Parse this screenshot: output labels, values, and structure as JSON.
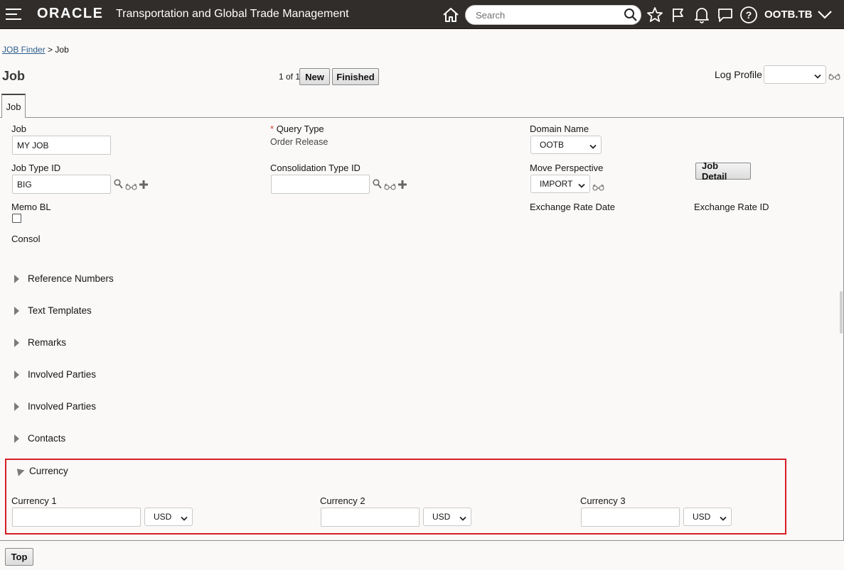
{
  "header": {
    "brand": "ORACLE",
    "app_title": "Transportation and Global Trade Management",
    "search_placeholder": "Search",
    "user": "OOTB.TB"
  },
  "breadcrumb": {
    "link": "JOB Finder",
    "separator": ">",
    "current": "Job"
  },
  "page": {
    "title": "Job",
    "count": "1 of 1",
    "new_label": "New",
    "finished_label": "Finished",
    "log_profile_label": "Log Profile",
    "log_profile_value": ""
  },
  "tab": {
    "label": "Job"
  },
  "form": {
    "job_label": "Job",
    "job_value": "MY JOB",
    "query_type_required": "*",
    "query_type_label": "Query Type",
    "query_type_value": "Order Release",
    "domain_name_label": "Domain Name",
    "domain_name_value": "OOTB",
    "job_type_label": "Job Type ID",
    "job_type_value": "BIG",
    "consolidation_label": "Consolidation Type ID",
    "consolidation_value": "",
    "move_perspective_label": "Move Perspective",
    "move_perspective_value": "IMPORT",
    "job_detail_label": "Job Detail",
    "memo_bl_label": "Memo BL",
    "exchange_rate_date_label": "Exchange Rate Date",
    "exchange_rate_id_label": "Exchange Rate ID",
    "consol_label": "Consol"
  },
  "sections": [
    "Reference Numbers",
    "Text Templates",
    "Remarks",
    "Involved Parties",
    "Involved Parties",
    "Contacts"
  ],
  "currency": {
    "title": "Currency",
    "fields": [
      {
        "label": "Currency 1",
        "value": "",
        "unit": "USD"
      },
      {
        "label": "Currency 2",
        "value": "",
        "unit": "USD"
      },
      {
        "label": "Currency 3",
        "value": "",
        "unit": "USD"
      }
    ]
  },
  "footer": {
    "top_label": "Top"
  },
  "colors": {
    "header_bg": "#312d2a",
    "highlight": "#d61e26",
    "link": "#2c5e8f"
  }
}
